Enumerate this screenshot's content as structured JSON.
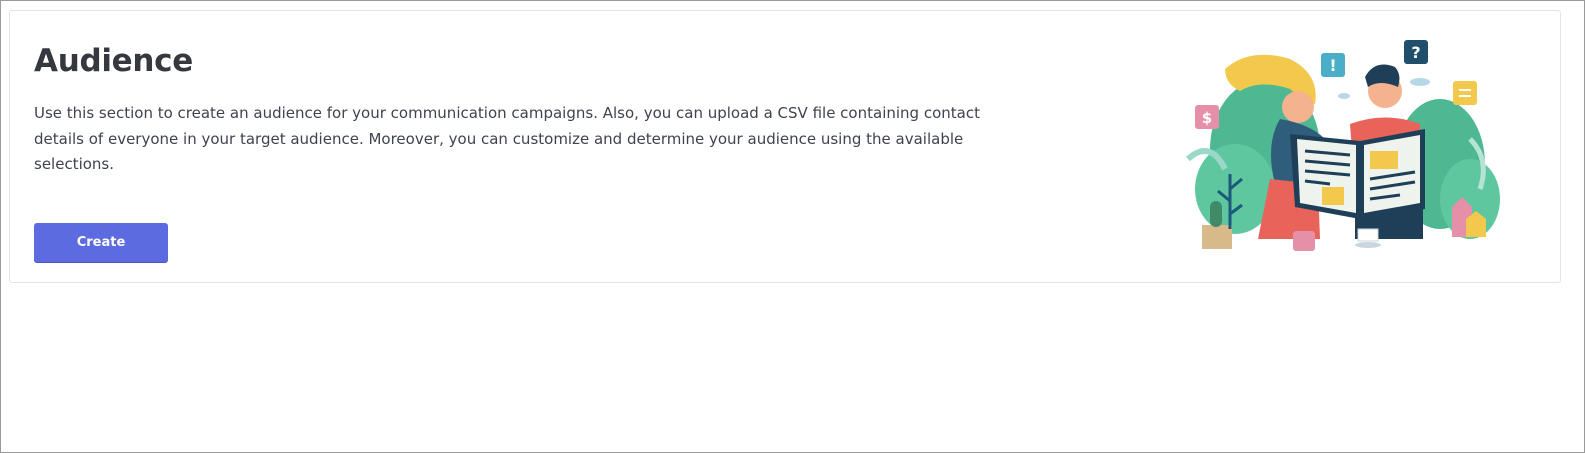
{
  "audience": {
    "title": "Audience",
    "description": "Use this section to create an audience for your communication campaigns. Also, you can upload a CSV file containing contact details of everyone in your target audience. Moreover, you can customize and determine your audience using the available selections.",
    "create_label": "Create"
  },
  "illustration": {
    "icons": [
      "exclamation-bubble-icon",
      "question-bubble-icon",
      "dollar-bubble-icon",
      "menu-bubble-icon"
    ],
    "exclamation": "!",
    "question": "?",
    "dollar": "$"
  },
  "colors": {
    "accent": "#5c6be0",
    "title": "#35383f",
    "text": "#3f4350"
  }
}
